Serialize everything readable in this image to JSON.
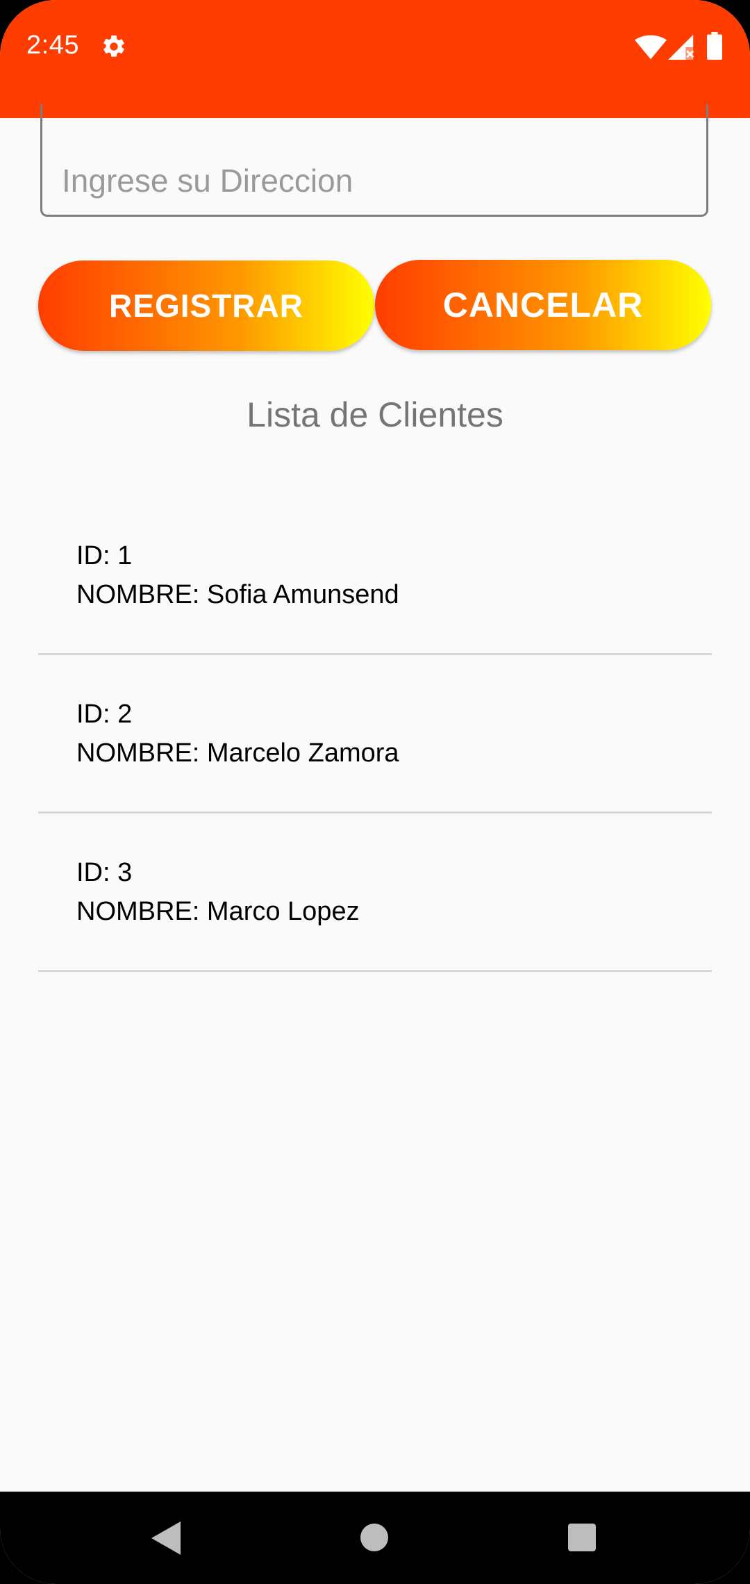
{
  "status_bar": {
    "time": "2:45",
    "icons": [
      "gear-icon",
      "wifi-icon",
      "signal-icon",
      "battery-icon"
    ],
    "background_color": "#ff3d00"
  },
  "form": {
    "address_placeholder": "Ingrese su Direccion",
    "address_value": ""
  },
  "buttons": {
    "registrar_label": "REGISTRAR",
    "cancelar_label": "CANCELAR",
    "gradient_colors": [
      "#ff3d00",
      "#ff9800",
      "#ffff00"
    ]
  },
  "list": {
    "title": "Lista de Clientes",
    "items": [
      {
        "id": "ID: 1",
        "name": "NOMBRE: Sofia Amunsend"
      },
      {
        "id": "ID: 2",
        "name": "NOMBRE: Marcelo Zamora"
      },
      {
        "id": "ID: 3",
        "name": "NOMBRE: Marco Lopez"
      }
    ]
  },
  "nav_bar": {
    "icons": [
      "back-icon",
      "home-icon",
      "recents-icon"
    ]
  }
}
